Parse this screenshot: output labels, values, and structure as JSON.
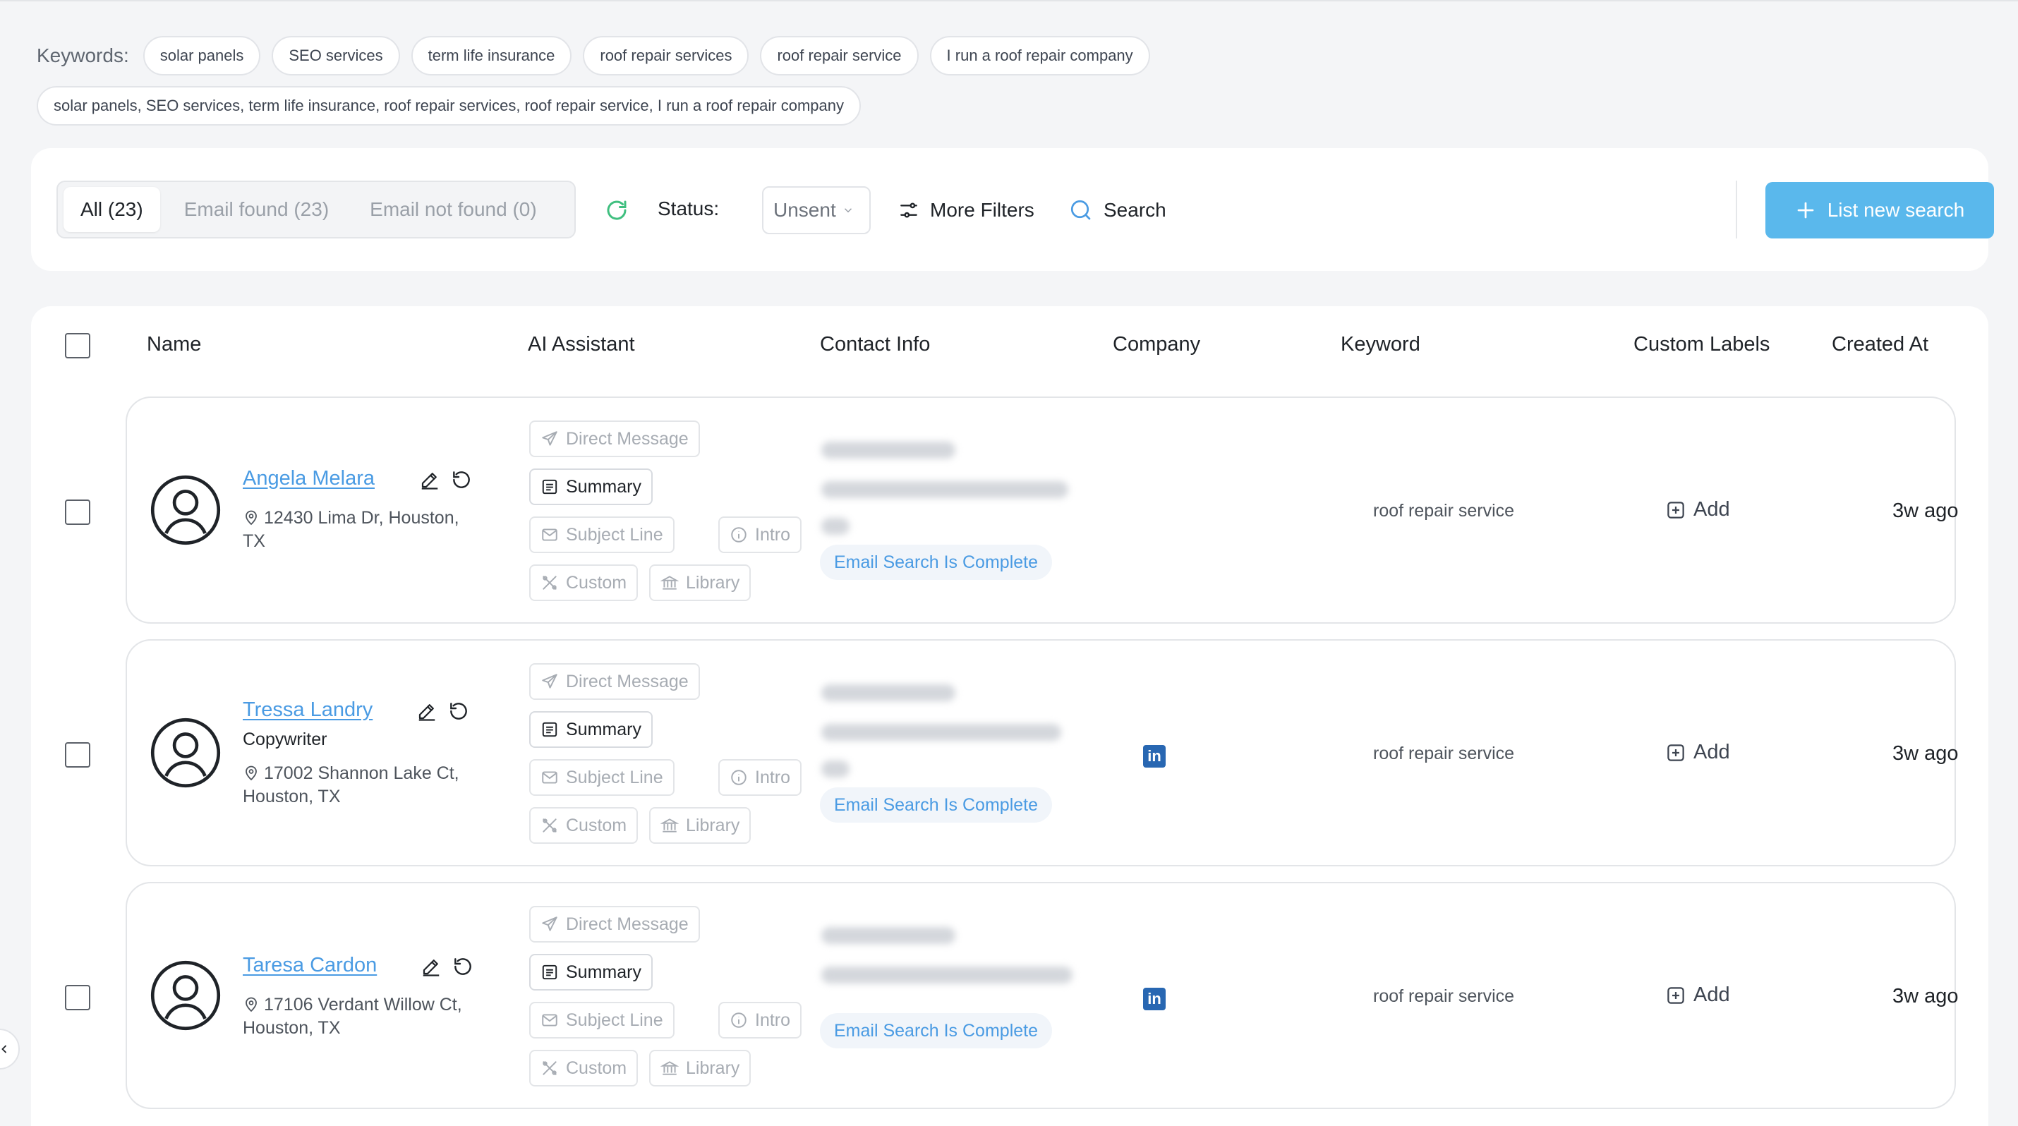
{
  "keywords": {
    "label": "Keywords:",
    "chips": [
      "solar panels",
      "SEO services",
      "term life insurance",
      "roof repair services",
      "roof repair service",
      "I run a roof repair company"
    ],
    "combined": "solar panels, SEO services, term life insurance, roof repair services, roof repair service, I run a roof repair company"
  },
  "filters": {
    "tabs": [
      "All (23)",
      "Email found (23)",
      "Email not found (0)"
    ],
    "status_label": "Status:",
    "status_value": "Unsent",
    "more_filters": "More Filters",
    "search": "Search",
    "new_search": "List new search"
  },
  "table": {
    "headers": [
      "Name",
      "AI Assistant",
      "Contact Info",
      "Company",
      "Keyword",
      "Custom Labels",
      "Created At"
    ],
    "ai_buttons": {
      "direct_message": "Direct Message",
      "summary": "Summary",
      "subject_line": "Subject Line",
      "intro": "Intro",
      "custom": "Custom",
      "library": "Library"
    },
    "rows": [
      {
        "name": "Angela Melara",
        "job": "",
        "address": "12430 Lima Dr, Houston, TX",
        "email_status": "Email Search Is Complete",
        "linkedin": false,
        "keyword": "roof repair service",
        "add_label": "Add",
        "created": "3w ago"
      },
      {
        "name": "Tressa Landry",
        "job": "Copywriter",
        "address": "17002 Shannon Lake Ct, Houston, TX",
        "email_status": "Email Search Is Complete",
        "linkedin": true,
        "keyword": "roof repair service",
        "add_label": "Add",
        "created": "3w ago"
      },
      {
        "name": "Taresa Cardon",
        "job": "",
        "address": "17106 Verdant Willow Ct, Houston, TX",
        "email_status": "Email Search Is Complete",
        "linkedin": true,
        "keyword": "roof repair service",
        "add_label": "Add",
        "created": "3w ago"
      }
    ]
  },
  "colors": {
    "accent": "#5ab8ec",
    "link": "#4a9be3",
    "linkedin": "#2867b2",
    "refresh": "#3fbf7f"
  },
  "icons": {
    "refresh": "refresh-icon",
    "filters": "sliders-icon",
    "search": "search-icon",
    "plus": "plus-icon",
    "avatar": "user-avatar-icon",
    "edit": "pencil-icon",
    "undo": "rotate-icon",
    "location": "map-pin-icon",
    "send": "send-icon",
    "summary": "document-icon",
    "mail": "mail-icon",
    "info": "info-icon",
    "custom": "tools-icon",
    "library": "library-icon",
    "linkedin": "linkedin-icon",
    "add": "plus-square-icon",
    "collapse": "chevron-left-icon"
  }
}
